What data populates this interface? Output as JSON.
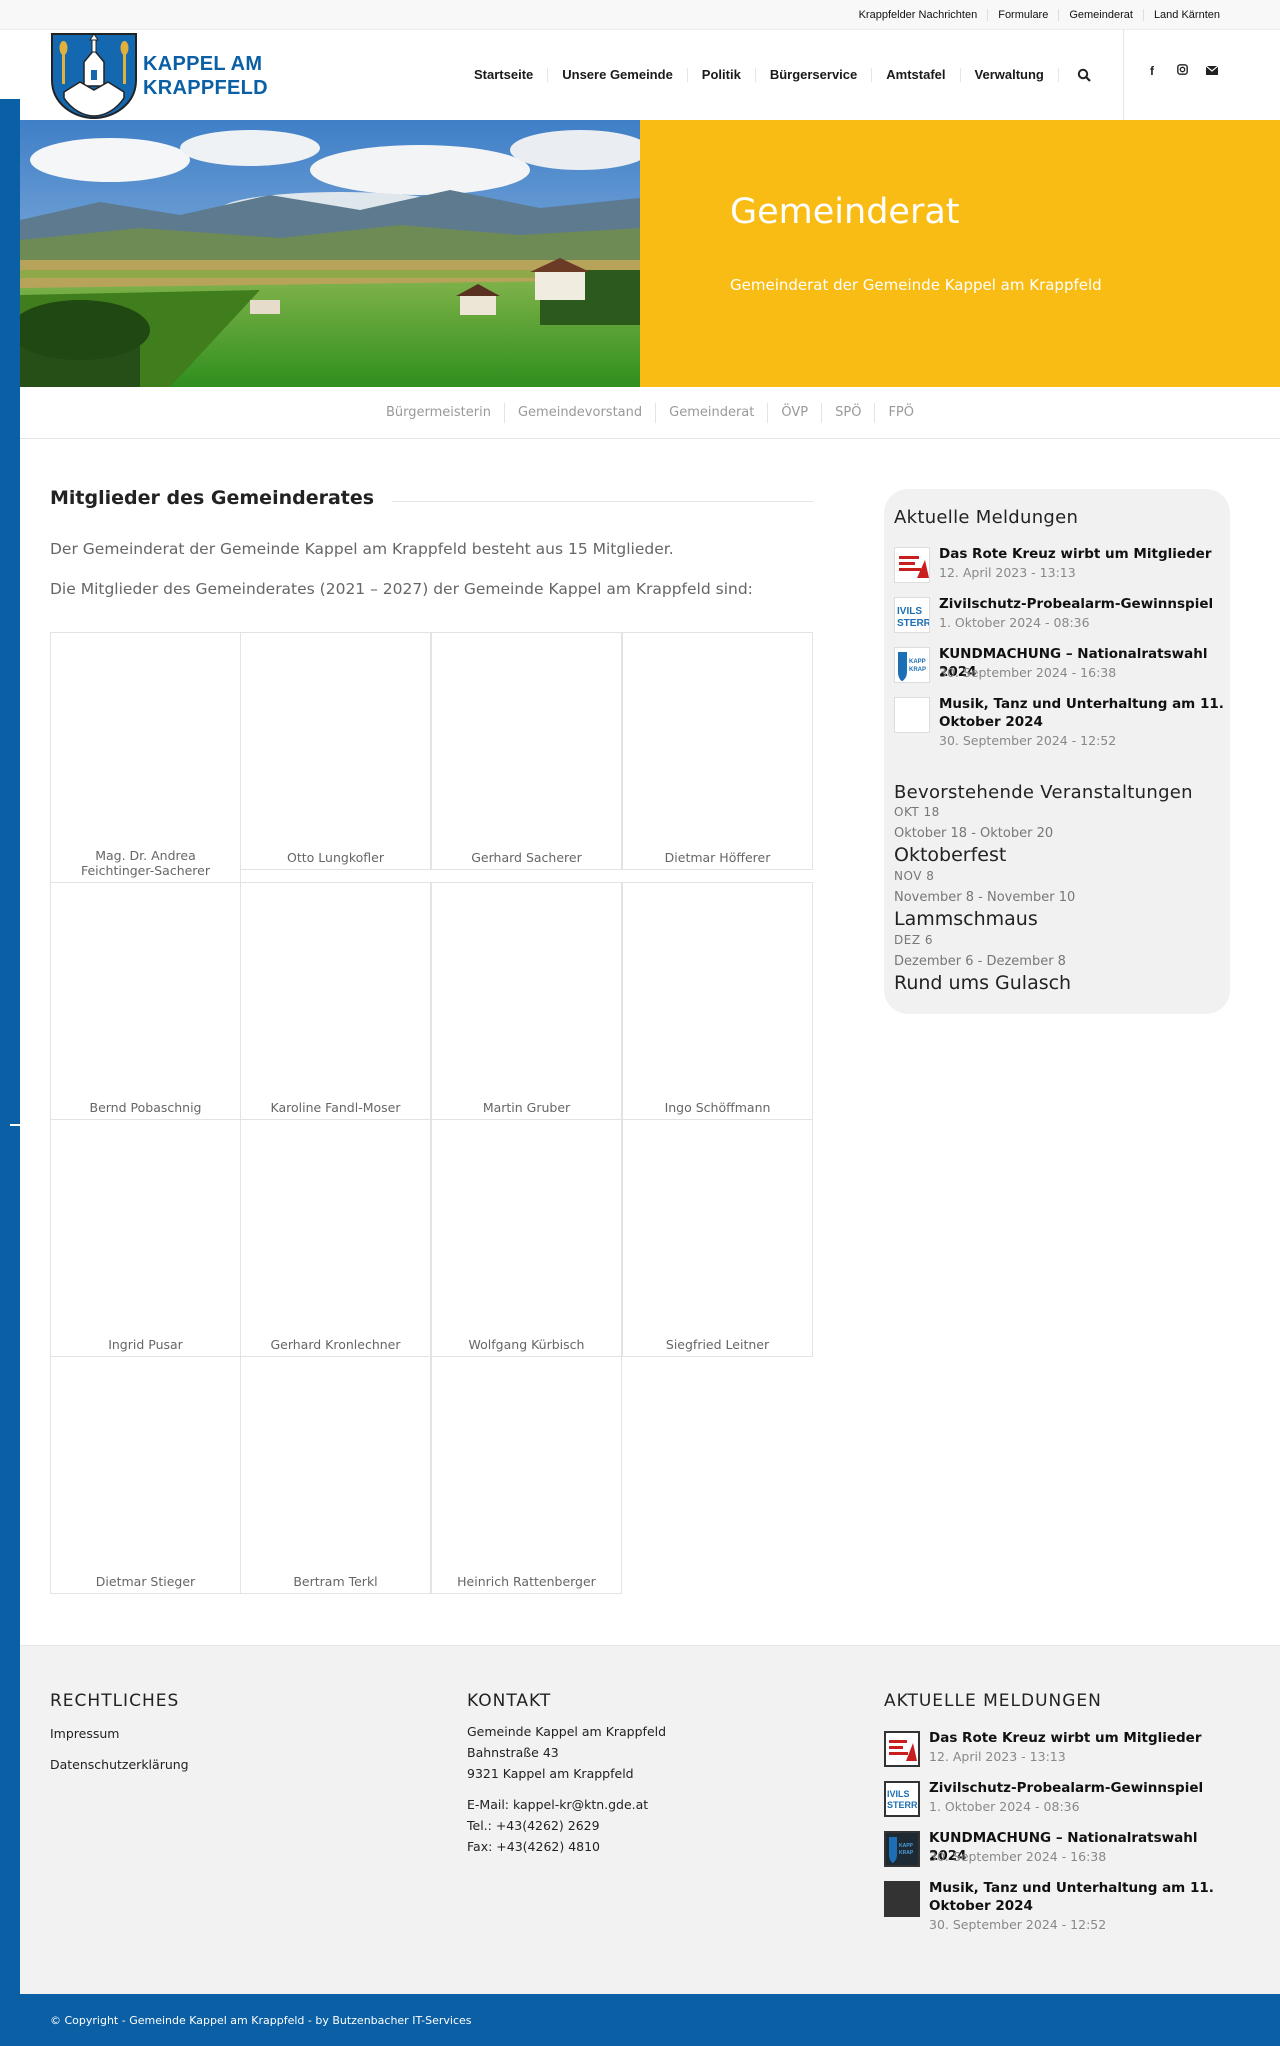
{
  "topbar": {
    "links": [
      "Krappfelder Nachrichten",
      "Formulare",
      "Gemeinderat",
      "Land Kärnten"
    ]
  },
  "header": {
    "logo_line1": "KAPPEL AM",
    "logo_line2": "KRAPPFELD",
    "nav": [
      "Startseite",
      "Unsere Gemeinde",
      "Politik",
      "Bürgerservice",
      "Amtstafel",
      "Verwaltung"
    ],
    "social_icons": [
      "facebook-icon",
      "instagram-icon",
      "mail-icon"
    ]
  },
  "hero": {
    "title": "Gemeinderat",
    "subtitle": "Gemeinderat der Gemeinde Kappel am Krappfeld",
    "accent": "#f9bc15"
  },
  "subnav": [
    "Bürgermeisterin",
    "Gemeindevorstand",
    "Gemeinderat",
    "ÖVP",
    "SPÖ",
    "FPÖ"
  ],
  "main": {
    "heading": "Mitglieder des Gemeinderates",
    "intro1": "Der Gemeinderat der Gemeinde Kappel am Krappfeld besteht aus 15 Mitglieder.",
    "intro2": "Die Mitglieder des Gemeinderates (2021 – 2027) der Gemeinde Kappel am Krappfeld sind:",
    "members": [
      "Mag. Dr. Andrea Feichtinger-Sacherer",
      "Otto Lungkofler",
      "Gerhard Sacherer",
      "Dietmar Höfferer",
      "Bernd Pobaschnig",
      "Karoline Fandl-Moser",
      "Martin Gruber",
      "Ingo Schöffmann",
      "Ingrid Pusar",
      "Gerhard Kronlechner",
      "Wolfgang Kürbisch",
      "Siegfried Leitner",
      "Dietmar Stieger",
      "Bertram Terkl",
      "Heinrich Rattenberger"
    ]
  },
  "sidebar": {
    "news_title": "Aktuelle Meldungen",
    "news": [
      {
        "title": "Das Rote Kreuz wirbt um Mitglieder",
        "date": "12. April 2023 - 13:13"
      },
      {
        "title": "Zivilschutz-Probealarm-Gewinnspiel",
        "date": "1. Oktober 2024 - 08:36"
      },
      {
        "title": "KUNDMACHUNG – Nationalratswahl 2024",
        "date": "30. September 2024 - 16:38"
      },
      {
        "title": "Musik, Tanz und Unterhaltung am 11. Oktober 2024",
        "date": "30. September 2024 - 12:52"
      }
    ],
    "events_title": "Bevorstehende Veranstaltungen",
    "events": [
      {
        "abbr": "OKT 18",
        "range": "Oktober 18 - Oktober 20",
        "name": "Oktoberfest"
      },
      {
        "abbr": "NOV 8",
        "range": "November 8 - November 10",
        "name": "Lammschmaus"
      },
      {
        "abbr": "DEZ 6",
        "range": "Dezember 6 - Dezember 8",
        "name": "Rund ums Gulasch"
      }
    ]
  },
  "footer": {
    "legal_title": "RECHTLICHES",
    "legal_links": [
      "Impressum",
      "Datenschutzerklärung"
    ],
    "contact_title": "KONTAKT",
    "contact_lines": [
      "Gemeinde Kappel am Krappfeld",
      "Bahnstraße 43",
      "9321 Kappel am Krappfeld"
    ],
    "contact_lines2": [
      "E-Mail: kappel-kr@ktn.gde.at",
      "Tel.: +43(4262) 2629",
      "Fax: +43(4262) 4810"
    ],
    "news_title": "AKTUELLE MELDUNGEN",
    "news": [
      {
        "title": "Das Rote Kreuz wirbt um Mitglieder",
        "date": "12. April 2023 - 13:13"
      },
      {
        "title": "Zivilschutz-Probealarm-Gewinnspiel",
        "date": "1. Oktober 2024 - 08:36"
      },
      {
        "title": "KUNDMACHUNG – Nationalratswahl 2024",
        "date": "30. September 2024 - 16:38"
      },
      {
        "title": "Musik, Tanz und Unterhaltung am 11. Oktober 2024",
        "date": "30. September 2024 - 12:52"
      }
    ],
    "copyright": "© Copyright - Gemeinde Kappel am Krappfeld - by Butzenbacher IT-Services"
  },
  "colors": {
    "brand_blue": "#0a5fa5",
    "hero_yellow": "#f9bc15"
  }
}
